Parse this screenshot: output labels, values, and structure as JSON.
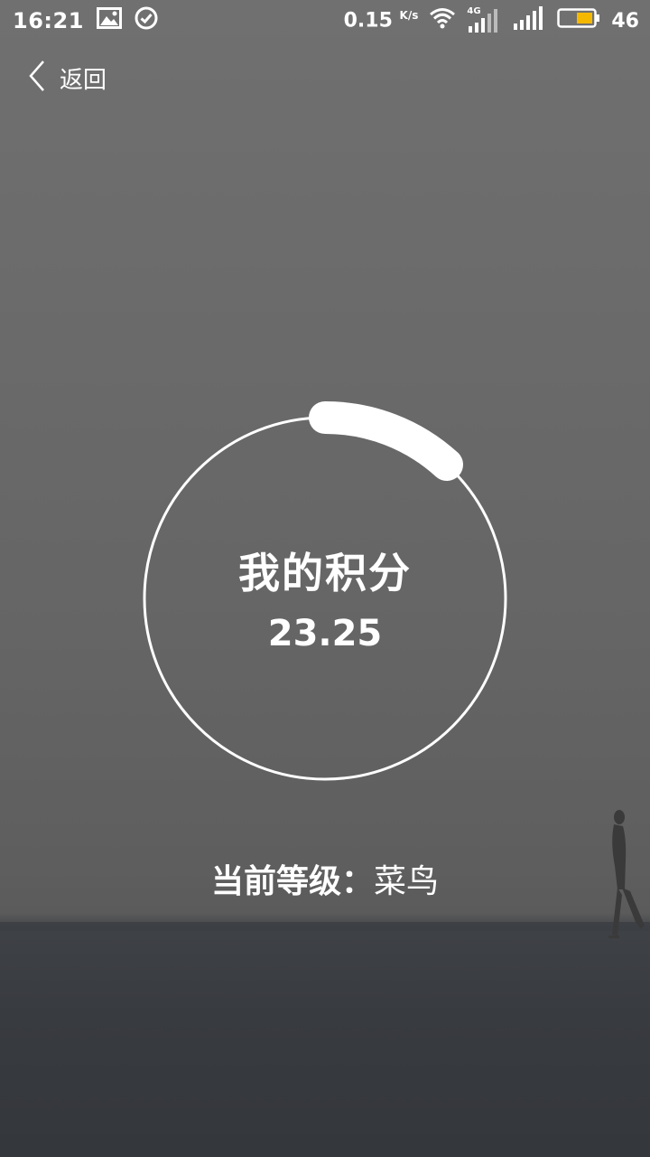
{
  "status_bar": {
    "time": "16:21",
    "net_speed": "0.15",
    "net_unit": "K/s",
    "network_type": "4G",
    "battery": "46",
    "icons": [
      "image-icon",
      "check-circle-icon",
      "wifi-icon",
      "signal-4g-icon",
      "signal-icon",
      "battery-icon"
    ]
  },
  "nav": {
    "back_label": "返回"
  },
  "score": {
    "title": "我的积分",
    "value": "23.25"
  },
  "level": {
    "label": "当前等级：",
    "value": "菜鸟"
  },
  "colors": {
    "text": "#ffffff",
    "ring": "#ffffff",
    "battery_fill": "#f5b800"
  }
}
